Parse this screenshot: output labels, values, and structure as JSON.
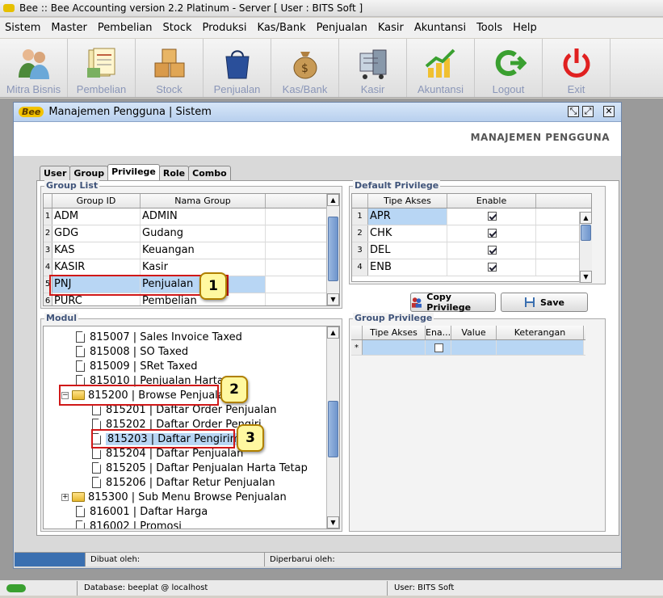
{
  "app": {
    "title": "Bee :: Bee Accounting version 2.2 Platinum - Server  [ User : BITS Soft ]"
  },
  "menu": [
    "Sistem",
    "Master",
    "Pembelian",
    "Stock",
    "Produksi",
    "Kas/Bank",
    "Penjualan",
    "Kasir",
    "Akuntansi",
    "Tools",
    "Help"
  ],
  "toolbar": {
    "items": [
      {
        "label": "Mitra Bisnis",
        "icon": "people-icon"
      },
      {
        "label": "Pembelian",
        "icon": "ledger-icon"
      },
      {
        "label": "Stock",
        "icon": "boxes-icon"
      },
      {
        "label": "Penjualan",
        "icon": "shopping-bag-icon"
      },
      {
        "label": "Kas/Bank",
        "icon": "money-bag-icon"
      },
      {
        "label": "Kasir",
        "icon": "cash-register-icon"
      },
      {
        "label": "Akuntansi",
        "icon": "chart-icon"
      },
      {
        "label": "Logout",
        "icon": "logout-icon"
      },
      {
        "label": "Exit",
        "icon": "power-icon"
      }
    ]
  },
  "window": {
    "title": "Manajemen Pengguna | Sistem",
    "logo": "Bee",
    "header": "MANAJEMEN PENGGUNA"
  },
  "tabs": [
    "User",
    "Group",
    "Privilege",
    "Role",
    "Combo"
  ],
  "active_tab": "Privilege",
  "group_list": {
    "legend": "Group List",
    "columns": [
      "Group ID",
      "Nama Group"
    ],
    "rows": [
      {
        "n": "1",
        "id": "ADM",
        "name": "ADMIN"
      },
      {
        "n": "2",
        "id": "GDG",
        "name": "Gudang"
      },
      {
        "n": "3",
        "id": "KAS",
        "name": "Keuangan"
      },
      {
        "n": "4",
        "id": "KASIR",
        "name": "Kasir"
      },
      {
        "n": "5",
        "id": "PNJ",
        "name": "Penjualan"
      },
      {
        "n": "6",
        "id": "PURC",
        "name": "Pembelian"
      }
    ]
  },
  "default_privilege": {
    "legend": "Default Privilege",
    "columns": [
      "Tipe Akses",
      "Enable"
    ],
    "rows": [
      {
        "n": "1",
        "type": "APR",
        "enabled": true
      },
      {
        "n": "2",
        "type": "CHK",
        "enabled": true
      },
      {
        "n": "3",
        "type": "DEL",
        "enabled": true
      },
      {
        "n": "4",
        "type": "ENB",
        "enabled": true
      }
    ]
  },
  "buttons": {
    "copy": "Copy Privilege",
    "save": "Save"
  },
  "modul": {
    "legend": "Modul",
    "items": [
      "815007 | Sales Invoice Taxed",
      "815008 | SO Taxed",
      "815009 | SRet Taxed",
      "815010 | Penjualan Harta Te",
      "815200 | Browse Penjualan",
      "815201 | Daftar Order Penjualan",
      "815202 | Daftar Order Pengiri",
      "815203 | Daftar Pengiriman",
      "815204 | Daftar Penjualan",
      "815205 | Daftar Penjualan Harta Tetap",
      "815206 | Daftar Retur Penjualan",
      "815300 | Sub Menu Browse Penjualan",
      "816001 | Daftar Harga",
      "816002 | Promosi"
    ]
  },
  "group_privilege": {
    "legend": "Group Privilege",
    "columns": [
      "Tipe Akses",
      "Ena...",
      "Value",
      "Keterangan"
    ],
    "new_row_marker": "*"
  },
  "callouts": [
    "1",
    "2",
    "3"
  ],
  "status": {
    "created": "Dibuat oleh:",
    "updated": "Diperbarui oleh:"
  },
  "dbbar": {
    "database": "Database: beeplat @ localhost",
    "user": "User: BITS Soft"
  }
}
